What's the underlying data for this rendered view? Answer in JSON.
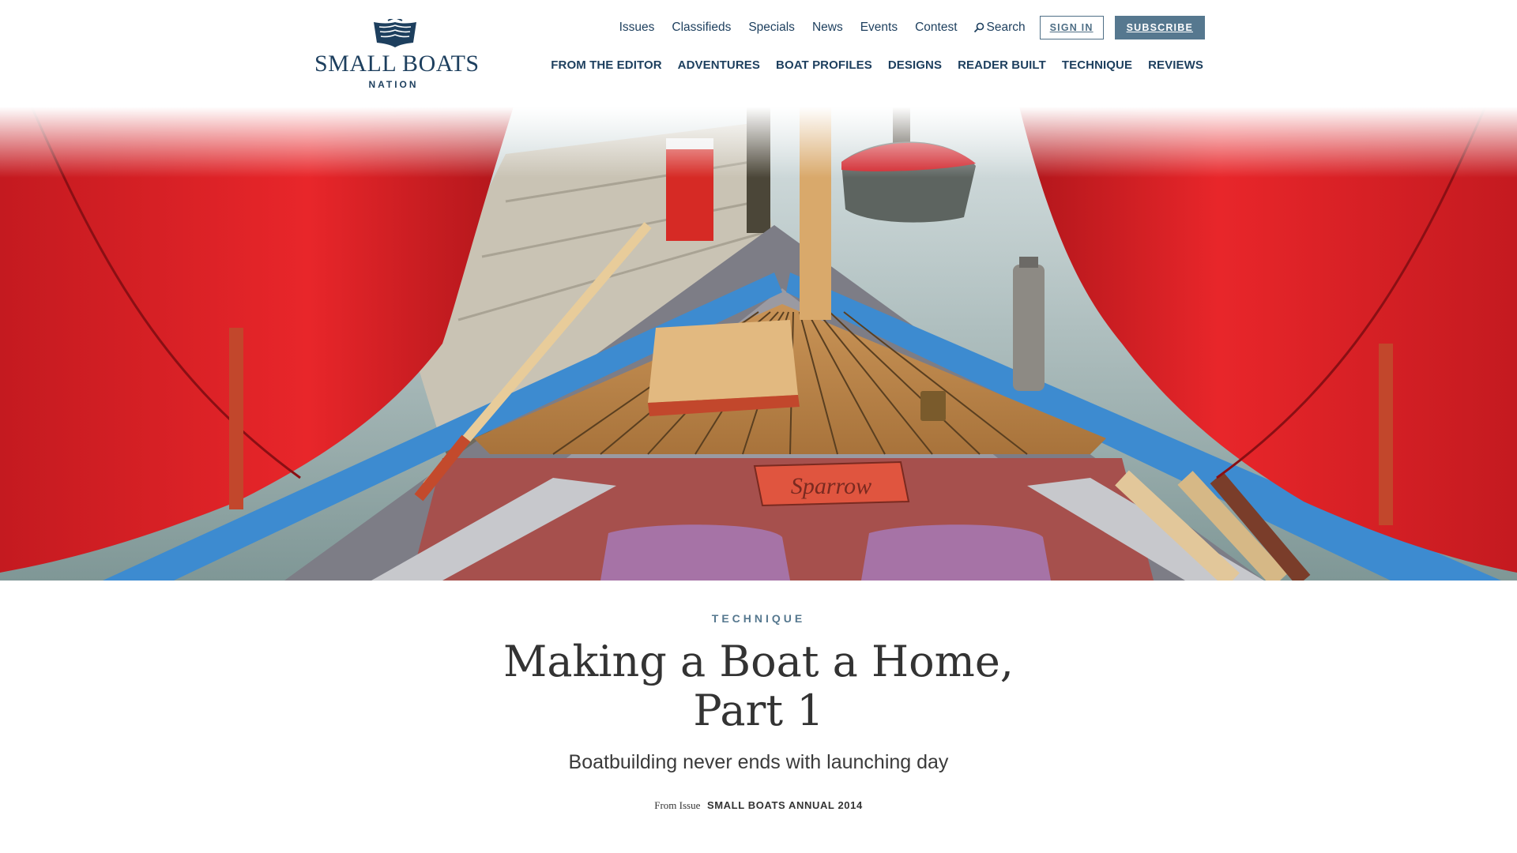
{
  "site": {
    "logo": {
      "title": "SMALL BOATS",
      "subtitle": "NATION"
    },
    "utility_nav": {
      "links": [
        "Issues",
        "Classifieds",
        "Specials",
        "News",
        "Events",
        "Contest"
      ],
      "search_label": "Search",
      "sign_in_label": "SIGN IN",
      "subscribe_label": "SUBSCRIBE"
    },
    "main_nav": [
      "FROM THE EDITOR",
      "ADVENTURES",
      "BOAT PROFILES",
      "DESIGNS",
      "READER BUILT",
      "TECHNIQUE",
      "REVIEWS"
    ],
    "colors": {
      "navy": "#1d3f5e",
      "slate_blue": "#56788f",
      "text": "#333333"
    }
  },
  "hero": {
    "nameboard_text": "Sparrow"
  },
  "article": {
    "category": "TECHNIQUE",
    "title": "Making a Boat a Home, Part 1",
    "subtitle": "Boatbuilding never ends with launching day",
    "from_issue_label": "From Issue",
    "issue_name": "SMALL BOATS ANNUAL 2014"
  }
}
